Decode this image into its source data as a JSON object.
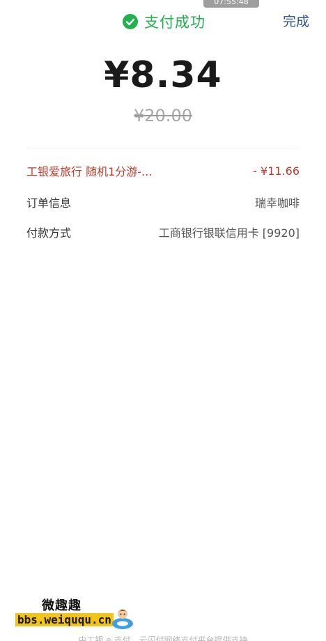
{
  "status_bar": {
    "time": "07:55:48"
  },
  "header": {
    "status_text": "支付成功",
    "done_label": "完成",
    "status_color": "#23b14d",
    "done_color": "#2f4f8f"
  },
  "payment": {
    "amount": "¥8.34",
    "original_amount": "¥20.00"
  },
  "details": [
    {
      "label": "工银爱旅行 随机1分游-...",
      "value": "- ¥11.66"
    },
    {
      "label": "订单信息",
      "value": "瑞幸咖啡"
    },
    {
      "label": "付款方式",
      "value": "工商银行银联信用卡 [9920]"
    }
  ],
  "footer": {
    "text": "由工银 e 支付、云闪付网络支付平台提供支持"
  },
  "watermark": {
    "title": "微趣趣",
    "url": "bbs.weiququ.cn"
  },
  "icons": {
    "status": "check-circle-icon"
  }
}
